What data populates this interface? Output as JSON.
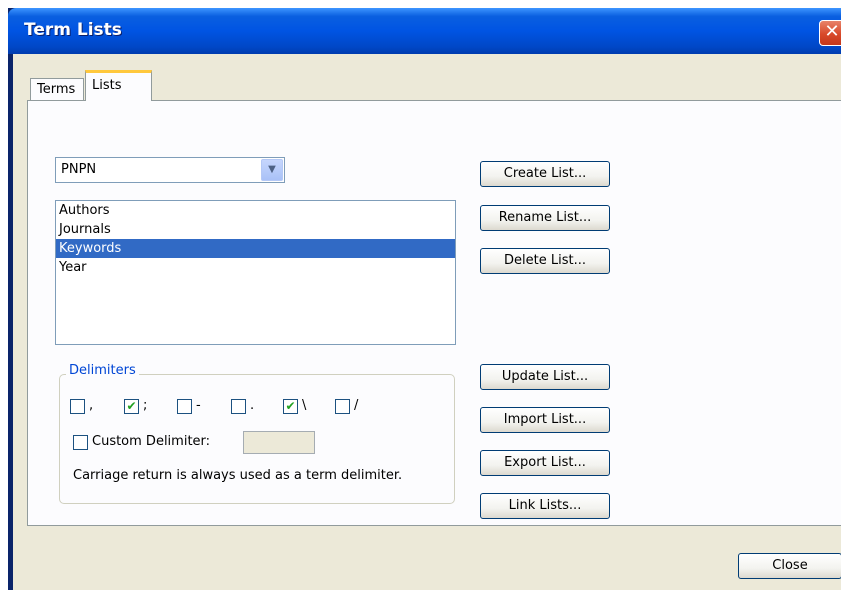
{
  "window": {
    "title": "Term Lists",
    "close_glyph": "✕"
  },
  "tabs": [
    {
      "label": "Terms",
      "active": false
    },
    {
      "label": "Lists",
      "active": true
    }
  ],
  "combo": {
    "value": "PNPN",
    "arrow": "▼"
  },
  "lists": {
    "items": [
      "Authors",
      "Journals",
      "Keywords",
      "Year"
    ],
    "selected_index": 2
  },
  "delimiters": {
    "legend": "Delimiters",
    "options": [
      {
        "char": ",",
        "checked": false
      },
      {
        "char": ";",
        "checked": true
      },
      {
        "char": "-",
        "checked": false
      },
      {
        "char": ".",
        "checked": false
      },
      {
        "char": "\\",
        "checked": true
      },
      {
        "char": "/",
        "checked": false
      }
    ],
    "check_glyph": "✔",
    "custom_label": "Custom Delimiter:",
    "custom_checked": false,
    "custom_value": "",
    "note": "Carriage return is always used as a term delimiter."
  },
  "buttons": {
    "create": "Create List...",
    "rename": "Rename List...",
    "delete": "Delete List...",
    "update": "Update List...",
    "import": "Import List...",
    "export": "Export List...",
    "link": "Link Lists...",
    "close": "Close"
  }
}
